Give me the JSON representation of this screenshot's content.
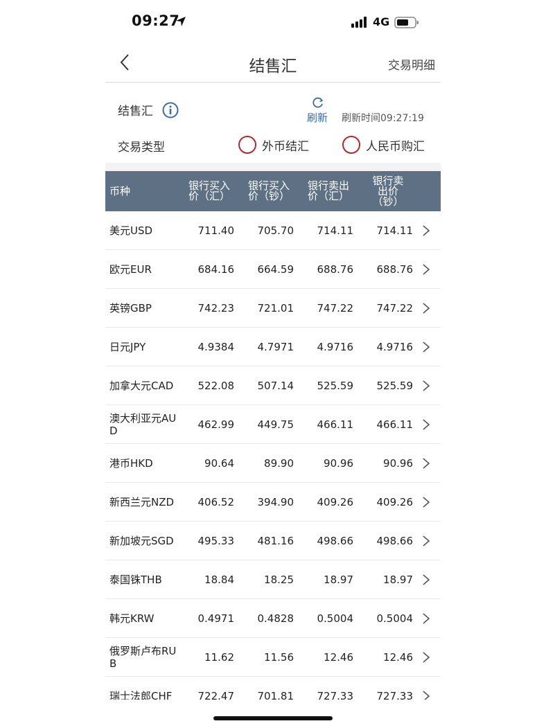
{
  "status_bar": {
    "time": "09:27",
    "network": "4G"
  },
  "nav": {
    "title": "结售汇",
    "right_link": "交易明细"
  },
  "info": {
    "section_label": "结售汇",
    "refresh_label": "刷新",
    "refresh_time": "刷新时间09:27:19"
  },
  "trade_type": {
    "label": "交易类型",
    "options": [
      "外币结汇",
      "人民币购汇"
    ]
  },
  "table": {
    "headers": [
      "币种",
      "银行买入价（汇）",
      "银行买入价（钞）",
      "银行卖出价（汇）",
      "银行卖出价（钞）"
    ],
    "header_lines": [
      [
        "币种"
      ],
      [
        "银行买入",
        "价（汇）"
      ],
      [
        "银行买入",
        "价（钞）"
      ],
      [
        "银行卖出",
        "价（汇）"
      ],
      [
        "银行卖",
        "出价",
        "（钞）"
      ]
    ],
    "rows": [
      {
        "name": "美元USD",
        "v": [
          "711.40",
          "705.70",
          "714.11",
          "714.11"
        ]
      },
      {
        "name": "欧元EUR",
        "v": [
          "684.16",
          "664.59",
          "688.76",
          "688.76"
        ]
      },
      {
        "name": "英镑GBP",
        "v": [
          "742.23",
          "721.01",
          "747.22",
          "747.22"
        ]
      },
      {
        "name": "日元JPY",
        "v": [
          "4.9384",
          "4.7971",
          "4.9716",
          "4.9716"
        ]
      },
      {
        "name": "加拿大元CAD",
        "v": [
          "522.08",
          "507.14",
          "525.59",
          "525.59"
        ]
      },
      {
        "name": "澳大利亚元AUD",
        "v": [
          "462.99",
          "449.75",
          "466.11",
          "466.11"
        ]
      },
      {
        "name": "港币HKD",
        "v": [
          "90.64",
          "89.90",
          "90.96",
          "90.96"
        ]
      },
      {
        "name": "新西兰元NZD",
        "v": [
          "406.52",
          "394.90",
          "409.26",
          "409.26"
        ]
      },
      {
        "name": "新加坡元SGD",
        "v": [
          "495.33",
          "481.16",
          "498.66",
          "498.66"
        ]
      },
      {
        "name": "泰国铢THB",
        "v": [
          "18.84",
          "18.25",
          "18.97",
          "18.97"
        ]
      },
      {
        "name": "韩元KRW",
        "v": [
          "0.4971",
          "0.4828",
          "0.5004",
          "0.5004"
        ]
      },
      {
        "name": "俄罗斯卢布RUB",
        "v": [
          "11.62",
          "11.56",
          "12.46",
          "12.46"
        ]
      },
      {
        "name": "瑞士法郎CHF",
        "v": [
          "722.47",
          "701.81",
          "727.33",
          "727.33"
        ]
      }
    ]
  },
  "colors": {
    "header_bg": "#5e7083",
    "accent_blue": "#3a6ab0",
    "radio_red": "#b8262c"
  },
  "icons": [
    "location-arrow-icon",
    "signal-icon",
    "battery-icon",
    "back-chevron-icon",
    "info-icon",
    "refresh-icon",
    "chevron-right-icon"
  ]
}
